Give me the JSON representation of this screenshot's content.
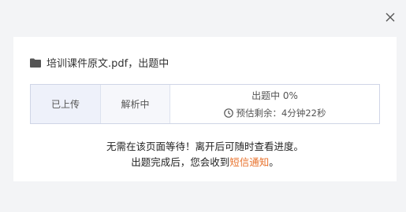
{
  "dialog": {
    "close_icon": "close-icon",
    "title": "培训课件原文.pdf，出题中",
    "steps": {
      "uploaded": "已上传",
      "parsing": "解析中",
      "generating": "出题中 0%",
      "eta_label": "预估剩余：4分钟22秒"
    },
    "notice": {
      "line1": "无需在该页面等待！离开后可随时查看进度。",
      "line2_prefix": "出题完成后，您会收到",
      "line2_link": "短信通知",
      "line2_suffix": "。"
    }
  },
  "colors": {
    "accent": "#e8712b",
    "step_done_bg": "#eef1fa",
    "border": "#cfd5e6"
  }
}
